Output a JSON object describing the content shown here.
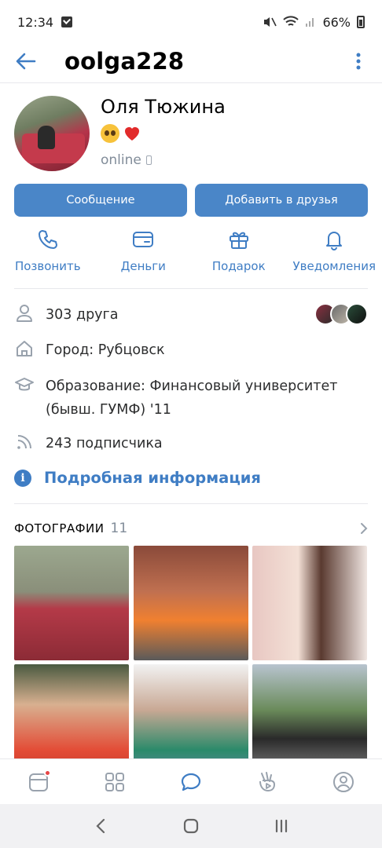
{
  "status_bar": {
    "time": "12:34",
    "battery": "66%"
  },
  "header": {
    "username": "oolga228"
  },
  "profile": {
    "name": "Оля Тюжина",
    "status": "online"
  },
  "buttons": {
    "message": "Сообщение",
    "add_friend": "Добавить в друзья"
  },
  "quick_actions": [
    {
      "label": "Позвонить",
      "icon": "phone-icon"
    },
    {
      "label": "Деньги",
      "icon": "wallet-icon"
    },
    {
      "label": "Подарок",
      "icon": "gift-icon"
    },
    {
      "label": "Уведомления",
      "icon": "bell-icon"
    }
  ],
  "info": {
    "friends": "303 друга",
    "city": "Город: Рубцовск",
    "education": "Образование: Финансовый университет (бывш. ГУМФ) '11",
    "followers": "243 подписчика",
    "more": "Подробная информация"
  },
  "photos": {
    "title": "ФОТОГРАФИИ",
    "count": "11"
  },
  "tab_bar": {
    "items": [
      "news-icon",
      "services-icon",
      "messages-icon",
      "clips-icon",
      "profile-icon"
    ]
  },
  "colors": {
    "accent": "#4a86c8",
    "link": "#3f7dc4",
    "secondary_text": "#818c99"
  }
}
